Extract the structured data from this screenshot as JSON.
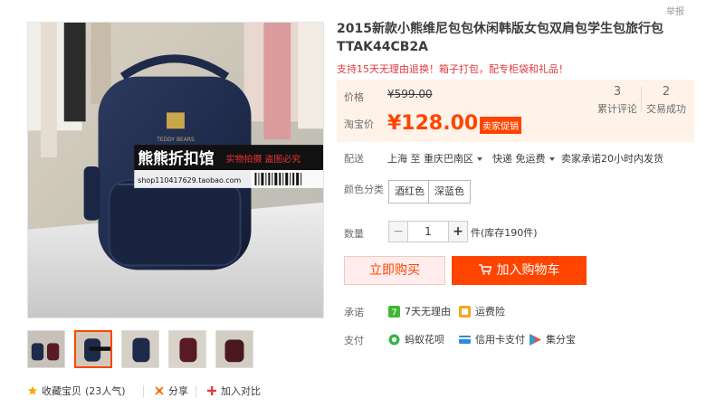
{
  "header": {
    "report_label": "举报"
  },
  "product": {
    "title": "2015新款小熊维尼包包休闲韩版女包双肩包学生包旅行包TTAK44CB2A",
    "subtitle": "支持15天无理由退换！箱子打包，配专柜袋和礼品！",
    "image": {
      "watermark_main": "熊熊折扣馆",
      "watermark_tag": "实物拍摄 盗图必究",
      "watermark_url": "shop110417629.taobao.com",
      "bag_logo": "TEDDY BEARS"
    }
  },
  "price": {
    "price_label": "价格",
    "original_price": "¥599.00",
    "promo_label": "淘宝价",
    "promo_price": "¥128.00",
    "promo_badge": "卖家促销",
    "stats": [
      {
        "value": "3",
        "label": "累计评论"
      },
      {
        "value": "2",
        "label": "交易成功"
      }
    ]
  },
  "delivery": {
    "label": "配送",
    "from": "上海 至",
    "to": "重庆巴南区",
    "method": "快递 免运费",
    "promise": "卖家承诺20小时内发货"
  },
  "sku": {
    "label": "颜色分类",
    "options": [
      "酒红色",
      "深蓝色"
    ]
  },
  "quantity": {
    "label": "数量",
    "minus": "−",
    "value": "1",
    "plus": "+",
    "stock": "件(库存190件)"
  },
  "actions": {
    "buy_now": "立即购买",
    "add_to_cart": "加入购物车"
  },
  "guarantees": {
    "label": "承诺",
    "items": [
      "7天无理由",
      "运费险"
    ]
  },
  "payment": {
    "label": "支付",
    "items": [
      "蚂蚁花呗",
      "信用卡支付",
      "集分宝"
    ]
  },
  "shop_tools": {
    "favorite": "收藏宝贝",
    "popularity": "(23人气)",
    "share": "分享",
    "compare": "加入对比"
  },
  "colors": {
    "accent": "#ff4400",
    "price_bg": "#fff2e8",
    "bag_navy": "#1e2a4a"
  }
}
